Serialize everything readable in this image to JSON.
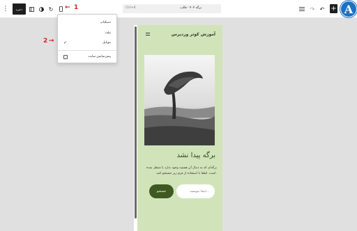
{
  "toolbar": {
    "save_label": "ذخیره",
    "shortcut": "Ctrl+K",
    "doc_title": "برگه ۴۰۴ · قالب",
    "plus_label": "+"
  },
  "logo": {
    "letter": "A",
    "color": "#1b72c4"
  },
  "annotations": [
    "1",
    "2"
  ],
  "menu": {
    "items": [
      {
        "label": "دسکتاپ",
        "checked": false
      },
      {
        "label": "تبلت",
        "checked": false
      },
      {
        "label": "موبایل",
        "checked": true
      }
    ],
    "check_mark": "✓",
    "preview_label": "پیش‌نمایش سایت"
  },
  "preview": {
    "site_title": "آموزش کوثر وردپرس",
    "heading": "برگه پیدا نشد",
    "paragraph": "برگه‌ای که به دنبال آن هستید وجود ندارد یا منتقل شده است. لطفا با استفاده از فرم زیر جستجو کنید.",
    "search_placeholder": "اینجا بنویسید...",
    "search_button": "جستجو",
    "background": "#d1e4b9",
    "button_color": "#3e5a21"
  }
}
